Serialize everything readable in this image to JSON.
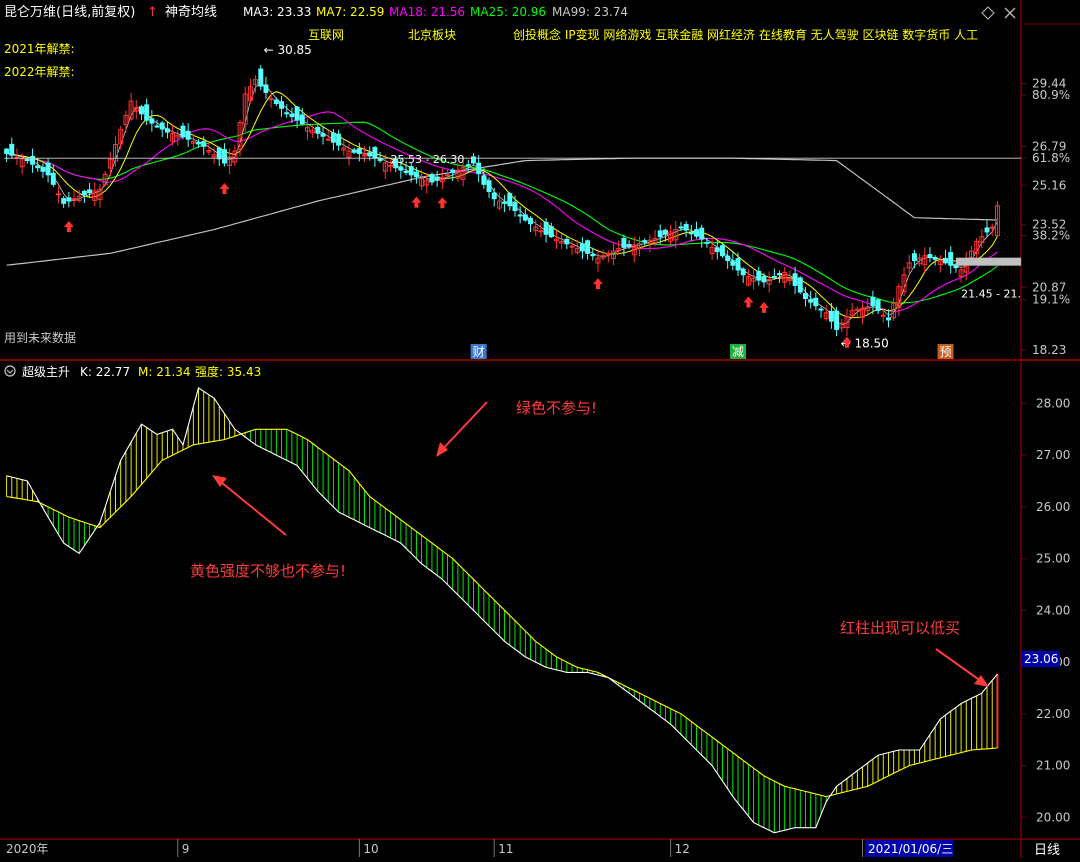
{
  "colors": {
    "bg": "#000000",
    "grid": "#7a0000",
    "axis_text": "#c8c8c8",
    "up": "#ff3232",
    "down": "#54ffff",
    "ma3": "#ffffff",
    "ma7": "#ffff00",
    "ma18": "#ff00ff",
    "ma25": "#00ff00",
    "ma99": "#c0c0c0",
    "k_line": "#ffffff",
    "m_line": "#ffff00",
    "bull_fill": "#ffff00",
    "bear_fill": "#00ff00",
    "annot": "#ff3b3b",
    "concept": "#ffff00"
  },
  "header": {
    "stock_name": "昆仑万维(日线,前复权)",
    "up_arrow": "↑",
    "indicator": "神奇均线",
    "ma3": "MA3: 23.33",
    "ma7": "MA7: 22.59",
    "ma18": "MA18: 21.56",
    "ma25": "MA25: 20.96",
    "ma99": "MA99: 23.74"
  },
  "concepts": [
    "互联网",
    "北京板块",
    "创投概念 IP变现 网络游戏 互联金融 网红经济 在线教育 无人驾驶 区块链 数字货币 人工"
  ],
  "unlock_labels": [
    "2021年解禁:",
    "2022年解禁:"
  ],
  "future_data_label": "用到未来数据",
  "price_axis": {
    "ylim": [
      17.9,
      31.9
    ],
    "labels": [
      "29.44",
      "80.9%",
      "26.79",
      "61.8%",
      "25.16",
      "23.52",
      "38.2%",
      "20.87",
      "19.1%",
      "18.23"
    ],
    "label_values": [
      29.44,
      28.95,
      26.79,
      26.3,
      25.16,
      23.52,
      23.05,
      20.87,
      20.35,
      18.23
    ],
    "current_price": "23.06"
  },
  "price_annotations": {
    "high": "30.85",
    "low": "18.50",
    "range1": "25.53 - 26.30",
    "range2": "21.45 - 21.",
    "ref_level": 26.3
  },
  "event_markers": [
    {
      "label": "财",
      "bar": 91,
      "color": "#3a78d0"
    },
    {
      "label": "减",
      "bar": 141,
      "color": "#20b040"
    },
    {
      "label": "预",
      "bar": 181,
      "color": "#c06020"
    }
  ],
  "indicator_header": {
    "name": "超级主升",
    "k": "K: 22.77",
    "m": "M: 21.34",
    "strength": "强度: 35.43"
  },
  "indicator_axis": {
    "ylim": [
      19.6,
      28.8
    ],
    "labels": [
      "28.00",
      "27.00",
      "26.00",
      "25.00",
      "24.00",
      "23.00",
      "22.00",
      "21.00",
      "20.00"
    ],
    "label_values": [
      28,
      27,
      26,
      25,
      24,
      23,
      22,
      21,
      20
    ],
    "current": "23.06"
  },
  "annotations": {
    "green": "绿色不参与!",
    "yellow": "黄色强度不够也不参与!",
    "red": "红柱出现可以低买"
  },
  "date_axis": {
    "labels": [
      "2020年",
      "9",
      "10",
      "11",
      "12",
      "1"
    ],
    "label_bars": [
      0,
      33,
      68,
      94,
      128,
      165
    ],
    "cursor_date": "2021/01/06/三",
    "period": "日线"
  },
  "chart_data": {
    "type": "candlestick",
    "bar_count": 192,
    "price": {
      "close_keypoints": [
        [
          0,
          26.5
        ],
        [
          4,
          26.2
        ],
        [
          8,
          25.6
        ],
        [
          11,
          24.4
        ],
        [
          14,
          24.7
        ],
        [
          18,
          25.0
        ],
        [
          22,
          27.5
        ],
        [
          24,
          28.7
        ],
        [
          27,
          27.9
        ],
        [
          31,
          27.4
        ],
        [
          34,
          27.2
        ],
        [
          38,
          26.8
        ],
        [
          42,
          26.1
        ],
        [
          44,
          26.6
        ],
        [
          46,
          29.0
        ],
        [
          48,
          29.6
        ],
        [
          51,
          28.8
        ],
        [
          54,
          28.2
        ],
        [
          58,
          27.6
        ],
        [
          62,
          27.1
        ],
        [
          66,
          26.6
        ],
        [
          70,
          26.4
        ],
        [
          74,
          26.0
        ],
        [
          78,
          25.6
        ],
        [
          82,
          25.3
        ],
        [
          86,
          25.7
        ],
        [
          88,
          25.9
        ],
        [
          90,
          26.1
        ],
        [
          92,
          25.2
        ],
        [
          94,
          24.6
        ],
        [
          97,
          24.3
        ],
        [
          100,
          23.7
        ],
        [
          104,
          23.1
        ],
        [
          108,
          22.7
        ],
        [
          112,
          22.3
        ],
        [
          114,
          22.1
        ],
        [
          118,
          22.5
        ],
        [
          122,
          22.7
        ],
        [
          126,
          23.0
        ],
        [
          130,
          23.4
        ],
        [
          134,
          22.9
        ],
        [
          138,
          22.2
        ],
        [
          142,
          21.4
        ],
        [
          146,
          21.1
        ],
        [
          150,
          21.5
        ],
        [
          154,
          20.4
        ],
        [
          158,
          19.8
        ],
        [
          160,
          19.1
        ],
        [
          163,
          19.9
        ],
        [
          167,
          20.1
        ],
        [
          170,
          19.5
        ],
        [
          172,
          20.9
        ],
        [
          174,
          21.9
        ],
        [
          177,
          22.2
        ],
        [
          181,
          21.9
        ],
        [
          184,
          21.6
        ],
        [
          187,
          22.8
        ],
        [
          190,
          23.4
        ],
        [
          191,
          24.3
        ]
      ],
      "ma99_keypoints": [
        [
          0,
          21.8
        ],
        [
          20,
          22.3
        ],
        [
          40,
          23.3
        ],
        [
          60,
          24.5
        ],
        [
          80,
          25.5
        ],
        [
          100,
          26.2
        ],
        [
          120,
          26.3
        ],
        [
          140,
          26.3
        ],
        [
          160,
          26.2
        ],
        [
          175,
          23.8
        ],
        [
          191,
          23.7
        ]
      ],
      "candle_amplitude": 0.45
    },
    "indicator": {
      "k_keypoints": [
        [
          0,
          26.6
        ],
        [
          4,
          26.5
        ],
        [
          8,
          25.8
        ],
        [
          11,
          25.3
        ],
        [
          14,
          25.1
        ],
        [
          18,
          25.7
        ],
        [
          22,
          26.9
        ],
        [
          26,
          27.6
        ],
        [
          29,
          27.4
        ],
        [
          32,
          27.5
        ],
        [
          34,
          27.2
        ],
        [
          37,
          28.3
        ],
        [
          40,
          28.1
        ],
        [
          44,
          27.5
        ],
        [
          48,
          27.2
        ],
        [
          52,
          27.0
        ],
        [
          56,
          26.8
        ],
        [
          60,
          26.3
        ],
        [
          64,
          25.9
        ],
        [
          68,
          25.7
        ],
        [
          72,
          25.5
        ],
        [
          76,
          25.3
        ],
        [
          80,
          24.9
        ],
        [
          84,
          24.6
        ],
        [
          88,
          24.2
        ],
        [
          92,
          23.8
        ],
        [
          96,
          23.4
        ],
        [
          100,
          23.1
        ],
        [
          104,
          22.9
        ],
        [
          108,
          22.8
        ],
        [
          112,
          22.8
        ],
        [
          116,
          22.7
        ],
        [
          120,
          22.4
        ],
        [
          124,
          22.1
        ],
        [
          128,
          21.8
        ],
        [
          132,
          21.4
        ],
        [
          136,
          21.0
        ],
        [
          140,
          20.4
        ],
        [
          144,
          19.9
        ],
        [
          148,
          19.7
        ],
        [
          152,
          19.8
        ],
        [
          156,
          19.8
        ],
        [
          158,
          20.3
        ],
        [
          160,
          20.6
        ],
        [
          164,
          20.9
        ],
        [
          168,
          21.2
        ],
        [
          172,
          21.3
        ],
        [
          176,
          21.3
        ],
        [
          180,
          21.9
        ],
        [
          184,
          22.2
        ],
        [
          188,
          22.4
        ],
        [
          191,
          22.77
        ]
      ],
      "m_keypoints": [
        [
          0,
          26.2
        ],
        [
          6,
          26.1
        ],
        [
          12,
          25.8
        ],
        [
          18,
          25.6
        ],
        [
          24,
          26.2
        ],
        [
          30,
          26.9
        ],
        [
          36,
          27.2
        ],
        [
          42,
          27.3
        ],
        [
          48,
          27.5
        ],
        [
          54,
          27.5
        ],
        [
          58,
          27.3
        ],
        [
          62,
          27.0
        ],
        [
          66,
          26.7
        ],
        [
          70,
          26.2
        ],
        [
          74,
          25.9
        ],
        [
          78,
          25.6
        ],
        [
          82,
          25.3
        ],
        [
          86,
          25.0
        ],
        [
          90,
          24.6
        ],
        [
          94,
          24.2
        ],
        [
          98,
          23.8
        ],
        [
          102,
          23.4
        ],
        [
          106,
          23.1
        ],
        [
          110,
          22.9
        ],
        [
          114,
          22.8
        ],
        [
          118,
          22.6
        ],
        [
          122,
          22.4
        ],
        [
          126,
          22.2
        ],
        [
          130,
          22.0
        ],
        [
          134,
          21.7
        ],
        [
          138,
          21.4
        ],
        [
          142,
          21.1
        ],
        [
          146,
          20.8
        ],
        [
          150,
          20.6
        ],
        [
          154,
          20.5
        ],
        [
          158,
          20.4
        ],
        [
          162,
          20.5
        ],
        [
          166,
          20.6
        ],
        [
          170,
          20.8
        ],
        [
          174,
          21.0
        ],
        [
          178,
          21.1
        ],
        [
          182,
          21.2
        ],
        [
          186,
          21.3
        ],
        [
          191,
          21.34
        ]
      ],
      "strength": 35.43
    }
  }
}
